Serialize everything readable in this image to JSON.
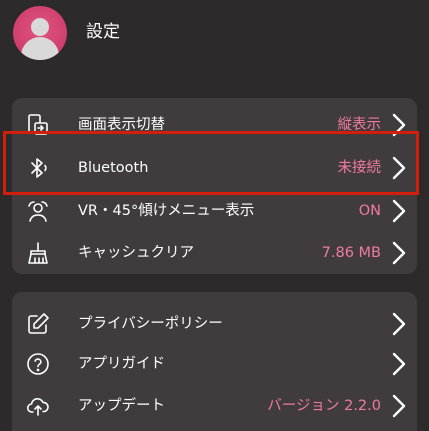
{
  "header": {
    "title": "設定",
    "avatar_icon": "user-avatar-icon"
  },
  "accent_color": "#f07aa0",
  "highlight_color": "#d21f0c",
  "section1": {
    "items": [
      {
        "label": "画面表示切替",
        "value": "縦表示",
        "icon": "screen-rotate-icon"
      },
      {
        "label": "Bluetooth",
        "value": "未接続",
        "icon": "bluetooth-icon"
      },
      {
        "label": "VR・45°傾けメニュー表示",
        "value": "ON",
        "icon": "vr-user-icon"
      },
      {
        "label": "キャッシュクリア",
        "value": "7.86 MB",
        "icon": "broom-icon"
      }
    ]
  },
  "section2": {
    "items": [
      {
        "label": "プライバシーポリシー",
        "value": "",
        "icon": "edit-icon"
      },
      {
        "label": "アプリガイド",
        "value": "",
        "icon": "help-circle-icon"
      },
      {
        "label": "アップデート",
        "value": "バージョン 2.2.0",
        "icon": "cloud-upload-icon"
      }
    ]
  }
}
